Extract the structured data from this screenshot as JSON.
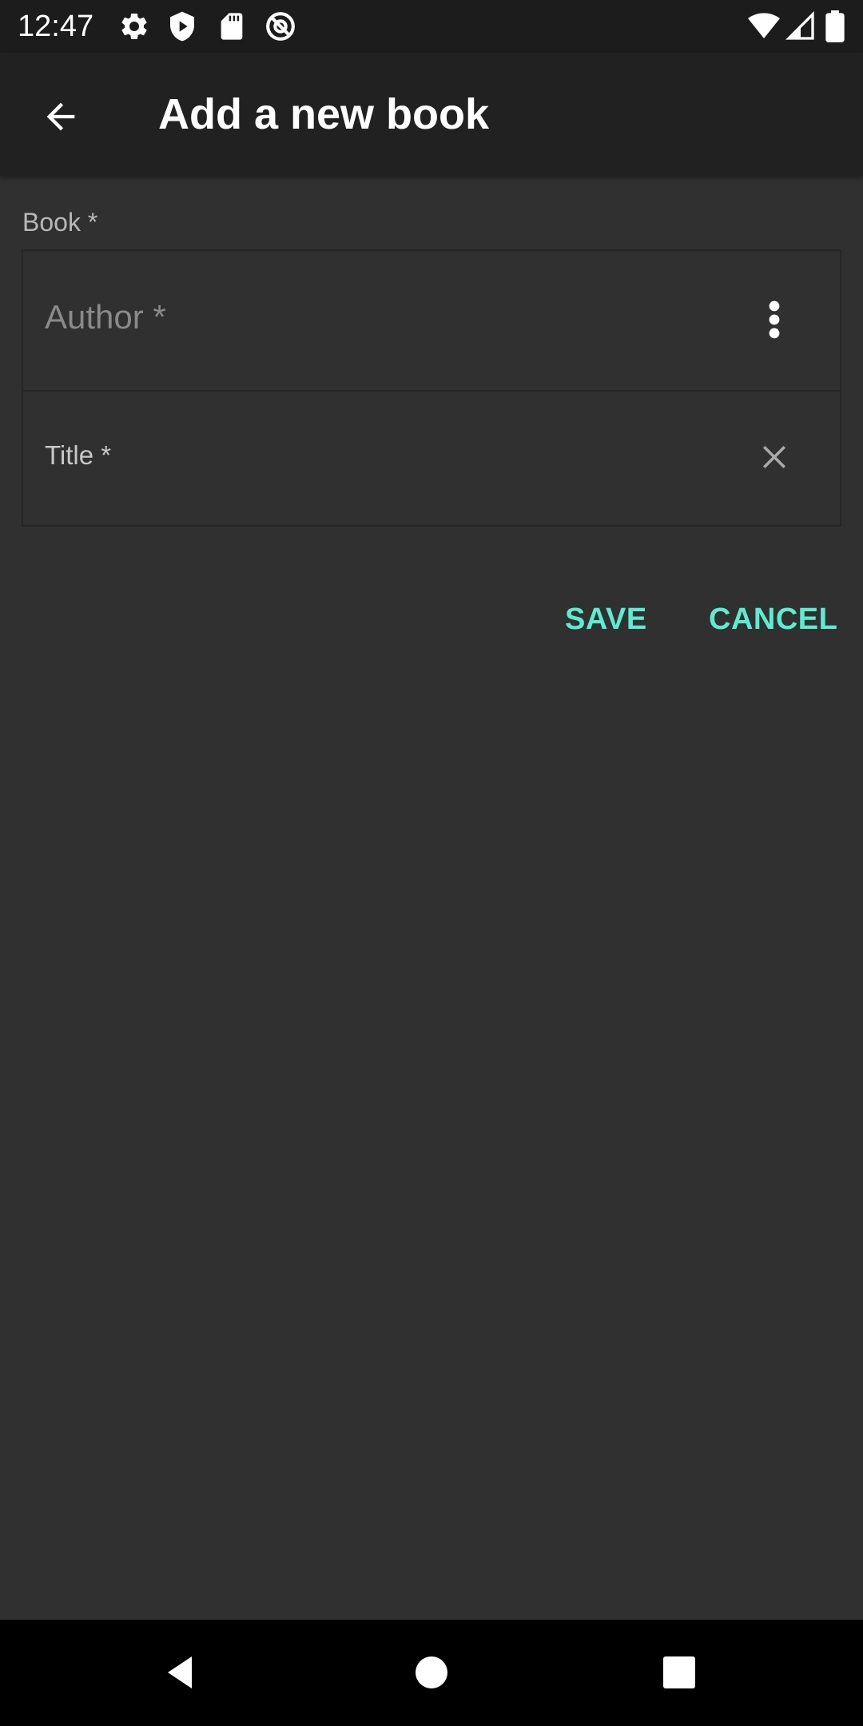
{
  "status_bar": {
    "time": "12:47",
    "left_icons": [
      "gear-icon",
      "shield-play-icon",
      "sd-card-icon",
      "no-tracking-icon"
    ],
    "right_icons": [
      "wifi-icon",
      "signal-icon",
      "battery-icon"
    ]
  },
  "app_bar": {
    "title": "Add a new book",
    "back_icon": "arrow-back-icon"
  },
  "form": {
    "section_label": "Book *",
    "author": {
      "placeholder": "Author *",
      "value": "",
      "menu_icon": "more-vert-icon"
    },
    "title": {
      "placeholder": "Title *",
      "value": "",
      "clear_icon": "close-icon"
    }
  },
  "actions": {
    "save_label": "SAVE",
    "cancel_label": "CANCEL"
  },
  "nav_bar": {
    "icons": [
      "back-triangle-icon",
      "home-circle-icon",
      "recents-square-icon"
    ]
  },
  "colors": {
    "background": "#303030",
    "app_bar": "#212121",
    "status_bar": "#1c1c1c",
    "accent": "#5eebd0",
    "nav_bar": "#000000"
  }
}
